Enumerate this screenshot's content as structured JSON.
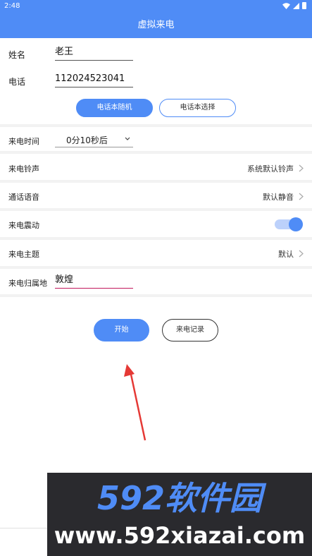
{
  "status_bar": {
    "time": "2:48"
  },
  "app_bar": {
    "title": "虚拟来电"
  },
  "form": {
    "name_label": "姓名",
    "name_value": "老王",
    "phone_label": "电话",
    "phone_value": "112024523041",
    "random_contact_button": "电话本随机",
    "select_contact_button": "电话本选择"
  },
  "settings": {
    "call_time_label": "来电时间",
    "call_time_value": "0分10秒后",
    "ringtone_label": "来电铃声",
    "ringtone_value": "系统默认铃声",
    "voice_label": "通话语音",
    "voice_value": "默认静音",
    "vibrate_label": "来电震动",
    "vibrate_on": true,
    "theme_label": "来电主题",
    "theme_value": "默认",
    "location_label": "来电归属地",
    "location_value": "敦煌"
  },
  "actions": {
    "start_button": "开始",
    "history_button": "来电记录"
  },
  "watermark": {
    "logo": "592软件园",
    "url": "www.592xiazai.com"
  },
  "colors": {
    "primary": "#4f8cf6",
    "annotation_arrow": "#e53935",
    "input_focus": "#c2185b"
  }
}
